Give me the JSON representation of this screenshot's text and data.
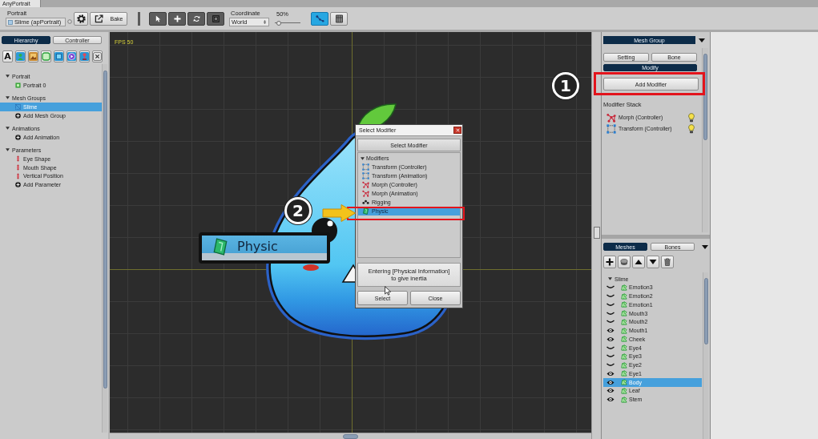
{
  "window": {
    "title": "AnyPortrait"
  },
  "toolbar": {
    "portrait_label": "Portrait",
    "portrait_field": "Slime (apPortrait)",
    "bake_button": "Bake",
    "coordinate_label": "Coordinate",
    "coordinate_value": "World",
    "zoom_label": "50%",
    "zoom_slider": {
      "level": 0.15
    },
    "view_toggles": [
      {
        "kind": "bones",
        "on": true
      },
      {
        "kind": "meshes",
        "on": false
      }
    ]
  },
  "hierarchy_panel": {
    "tabs": [
      {
        "label": "Hierarchy",
        "selected": true
      },
      {
        "label": "Controller",
        "selected": false
      }
    ],
    "filters": [
      {
        "kind": "text",
        "label": "A"
      },
      {
        "kind": "portrait"
      },
      {
        "kind": "image"
      },
      {
        "kind": "mesh"
      },
      {
        "kind": "mesh_group"
      },
      {
        "kind": "animation"
      },
      {
        "kind": "parameter"
      },
      {
        "kind": "clear"
      }
    ],
    "tree": [
      {
        "label": "Portrait",
        "expanded": true,
        "children": [
          {
            "label": "Portrait 0",
            "kind": "portrait",
            "selected": false
          }
        ]
      },
      {
        "label": "Mesh Groups",
        "expanded": true,
        "children": [
          {
            "label": "Slime",
            "kind": "mesh_group",
            "selected": true
          },
          {
            "label": "Add Mesh Group",
            "kind": "add",
            "selected": false
          }
        ]
      },
      {
        "label": "Animations",
        "expanded": true,
        "children": [
          {
            "label": "Add Animation",
            "kind": "add",
            "selected": false
          }
        ]
      },
      {
        "label": "Parameters",
        "expanded": true,
        "children": [
          {
            "label": "Eye Shape",
            "kind": "parameter",
            "selected": false
          },
          {
            "label": "Mouth Shape",
            "kind": "parameter",
            "selected": false
          },
          {
            "label": "Vertical Position",
            "kind": "parameter",
            "selected": false
          },
          {
            "label": "Add Parameter",
            "kind": "add",
            "selected": false
          }
        ]
      }
    ]
  },
  "canvas": {
    "fps": "FPS 50"
  },
  "dialog": {
    "title": "Select Modifier",
    "header": "Select Modifier",
    "group": {
      "label": "Modifiers",
      "expanded": true,
      "items": [
        {
          "label": "Transform (Controller)",
          "kind": "transform",
          "selected": false
        },
        {
          "label": "Transform (Animation)",
          "kind": "transform",
          "selected": false
        },
        {
          "label": "Morph (Controller)",
          "kind": "morph",
          "selected": false
        },
        {
          "label": "Morph (Animation)",
          "kind": "morph",
          "selected": false
        },
        {
          "label": "Rigging",
          "kind": "rigging",
          "selected": false
        },
        {
          "label": "Physic",
          "kind": "physic",
          "selected": true
        }
      ]
    },
    "description": "Entering [Physical Information]\nto give inertia",
    "buttons": [
      "Select",
      "Close"
    ]
  },
  "callout": {
    "label": "Physic"
  },
  "steps": [
    {
      "label": "1"
    },
    {
      "label": "2"
    }
  ],
  "mesh_group_panel": {
    "title": "Mesh Group",
    "tabs": [
      {
        "label": "Setting",
        "selected": false
      },
      {
        "label": "Bone",
        "selected": false
      },
      {
        "label": "Modify",
        "selected": true
      }
    ],
    "add_button": "Add Modifier",
    "stack_label": "Modifier Stack",
    "stack": [
      {
        "label": "Morph (Controller)",
        "kind": "morph",
        "on": true
      },
      {
        "label": "Transform (Controller)",
        "kind": "transform",
        "on": true
      }
    ]
  },
  "meshes_panel": {
    "tabs": [
      {
        "label": "Meshes",
        "selected": true
      },
      {
        "label": "Bones",
        "selected": false
      }
    ],
    "tree": {
      "label": "Slime",
      "expanded": true,
      "children": [
        {
          "label": "Emotion3",
          "visible": false,
          "selected": false
        },
        {
          "label": "Emotion2",
          "visible": false,
          "selected": false
        },
        {
          "label": "Emotion1",
          "visible": false,
          "selected": false
        },
        {
          "label": "Mouth3",
          "visible": false,
          "selected": false
        },
        {
          "label": "Mouth2",
          "visible": false,
          "selected": false
        },
        {
          "label": "Mouth1",
          "visible": true,
          "selected": false
        },
        {
          "label": "Cheek",
          "visible": true,
          "selected": false
        },
        {
          "label": "Eye4",
          "visible": false,
          "selected": false
        },
        {
          "label": "Eye3",
          "visible": false,
          "selected": false
        },
        {
          "label": "Eye2",
          "visible": false,
          "selected": false
        },
        {
          "label": "Eye1",
          "visible": true,
          "selected": false
        },
        {
          "label": "Body",
          "visible": true,
          "selected": true
        },
        {
          "label": "Leaf",
          "visible": true,
          "selected": false
        },
        {
          "label": "Stem",
          "visible": true,
          "selected": false
        }
      ]
    }
  }
}
